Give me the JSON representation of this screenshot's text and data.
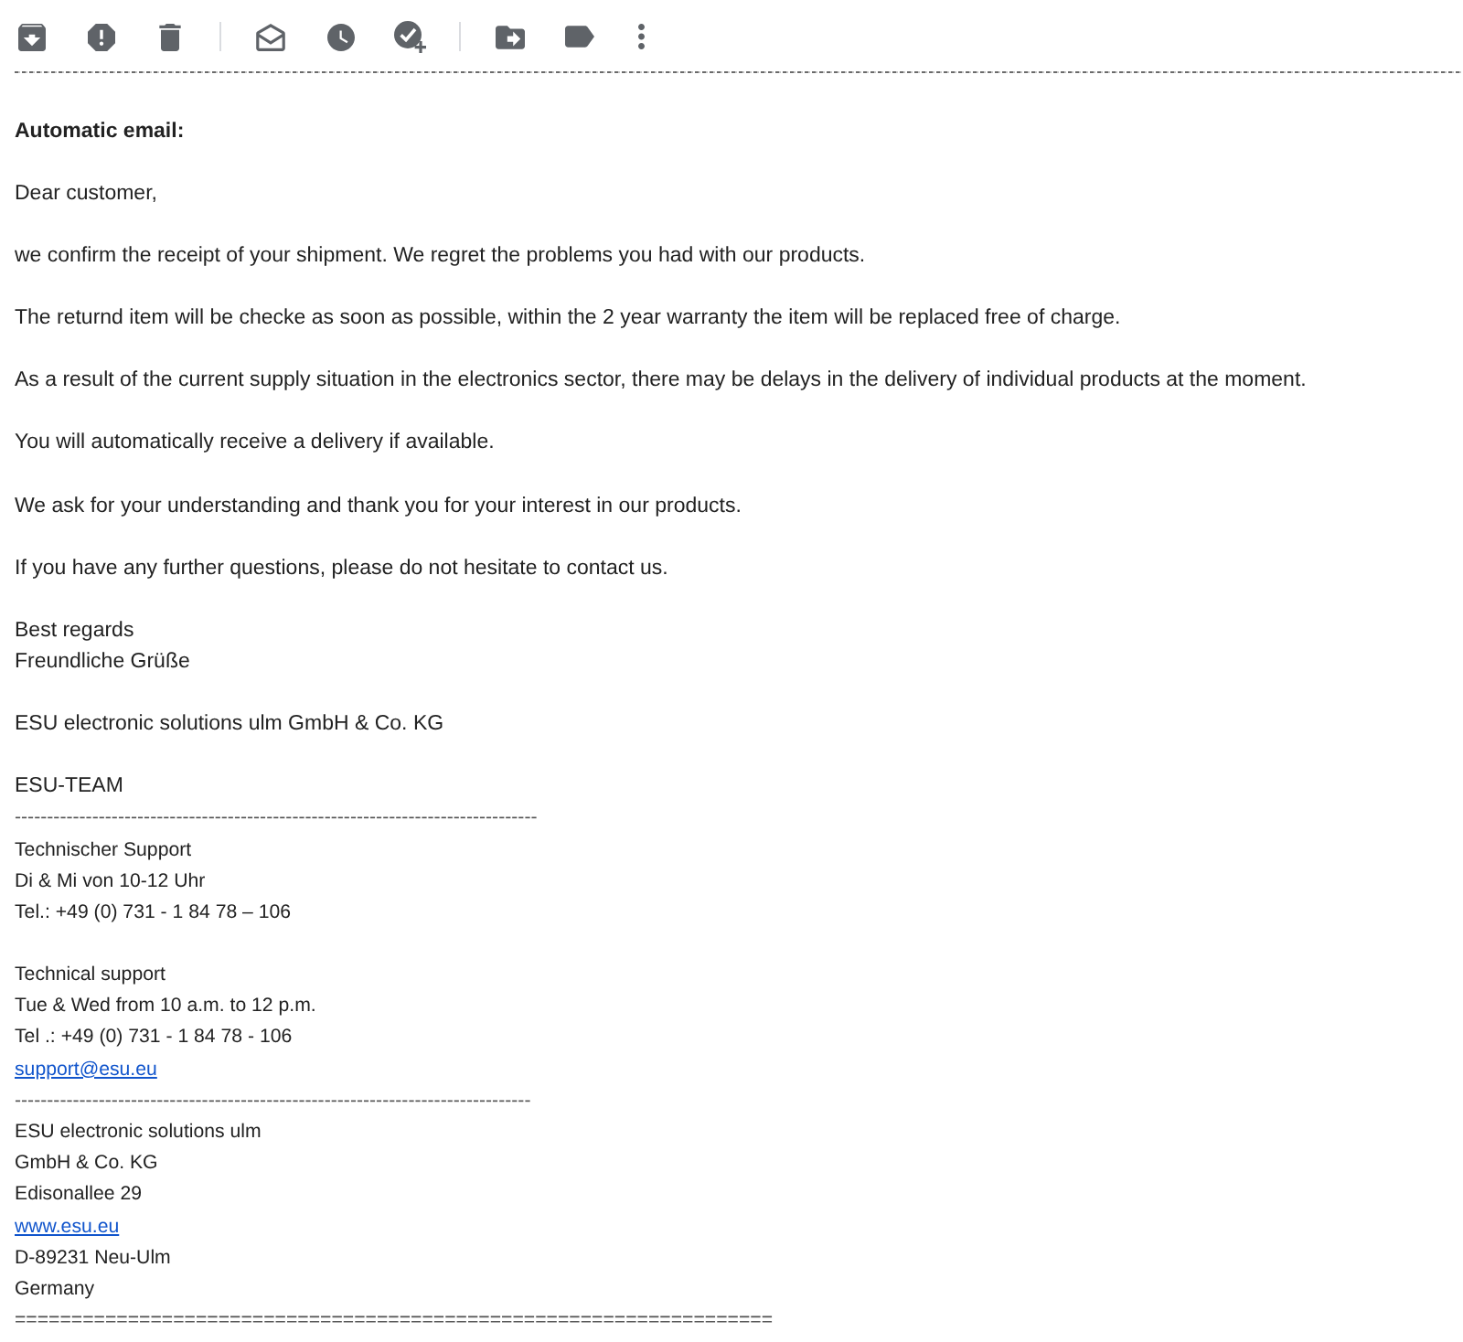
{
  "email": {
    "blocks": [
      {
        "kind": "heading",
        "lines": [
          {
            "kind": "text",
            "text": "Automatic email:"
          }
        ]
      },
      {
        "kind": "paragraph",
        "lines": [
          {
            "kind": "text",
            "text": "Dear customer,"
          }
        ]
      },
      {
        "kind": "paragraph",
        "lines": [
          {
            "kind": "text",
            "text": "we confirm the receipt of your shipment. We regret the problems you had with our products."
          }
        ]
      },
      {
        "kind": "paragraph",
        "lines": [
          {
            "kind": "text",
            "text": "The returnd item will be checke as soon as possible, within the 2 year warranty the item will be replaced free of charge."
          }
        ]
      },
      {
        "kind": "paragraph",
        "lines": [
          {
            "kind": "text",
            "text": "As a result of the current supply situation in the electronics sector, there may be delays in the delivery of individual products at the moment."
          }
        ]
      },
      {
        "kind": "paragraph",
        "lines": [
          {
            "kind": "text",
            "text": "You will automatically receive a delivery if available."
          }
        ]
      },
      {
        "kind": "paragraph",
        "lines": [
          {
            "kind": "text",
            "text": "We ask for your understanding and thank you for your interest in our products."
          }
        ]
      },
      {
        "kind": "paragraph",
        "lines": [
          {
            "kind": "text",
            "text": "If you have any further questions, please do not hesitate to contact us."
          }
        ]
      },
      {
        "kind": "paragraph",
        "lines": [
          {
            "kind": "text",
            "text": "Best regards"
          },
          {
            "kind": "text",
            "text": "Freundliche Grüße"
          }
        ]
      },
      {
        "kind": "paragraph",
        "lines": [
          {
            "kind": "text",
            "text": "ESU electronic solutions ulm GmbH & Co. KG"
          }
        ]
      },
      {
        "kind": "signature",
        "lines": [
          {
            "kind": "team",
            "text": "ESU-TEAM"
          },
          {
            "kind": "rule",
            "text": "---------------------------------------------------------------------------------"
          },
          {
            "kind": "text",
            "text": "Technischer Support"
          },
          {
            "kind": "text",
            "text": "Di & Mi von 10-12 Uhr"
          },
          {
            "kind": "text",
            "text": "Tel.: +49 (0) 731 - 1 84 78 – 106"
          }
        ]
      },
      {
        "kind": "signature",
        "lines": [
          {
            "kind": "text",
            "text": "Technical support"
          },
          {
            "kind": "text",
            "text": "Tue & Wed from 10 a.m. to 12 p.m."
          },
          {
            "kind": "text",
            "text": "Tel .: +49 (0) 731 - 1 84 78 - 106"
          },
          {
            "kind": "link",
            "text": "support@esu.eu"
          },
          {
            "kind": "rule",
            "text": "--------------------------------------------------------------------------------"
          },
          {
            "kind": "text",
            "text": "ESU electronic solutions ulm"
          },
          {
            "kind": "text",
            "text": "GmbH & Co. KG"
          },
          {
            "kind": "text",
            "text": "Edisonallee 29"
          },
          {
            "kind": "link",
            "text": "www.esu.eu"
          },
          {
            "kind": "text",
            "text": "D-89231 Neu-Ulm"
          },
          {
            "kind": "text",
            "text": "Germany"
          },
          {
            "kind": "rule",
            "text": "==================================================================="
          }
        ]
      }
    ]
  }
}
